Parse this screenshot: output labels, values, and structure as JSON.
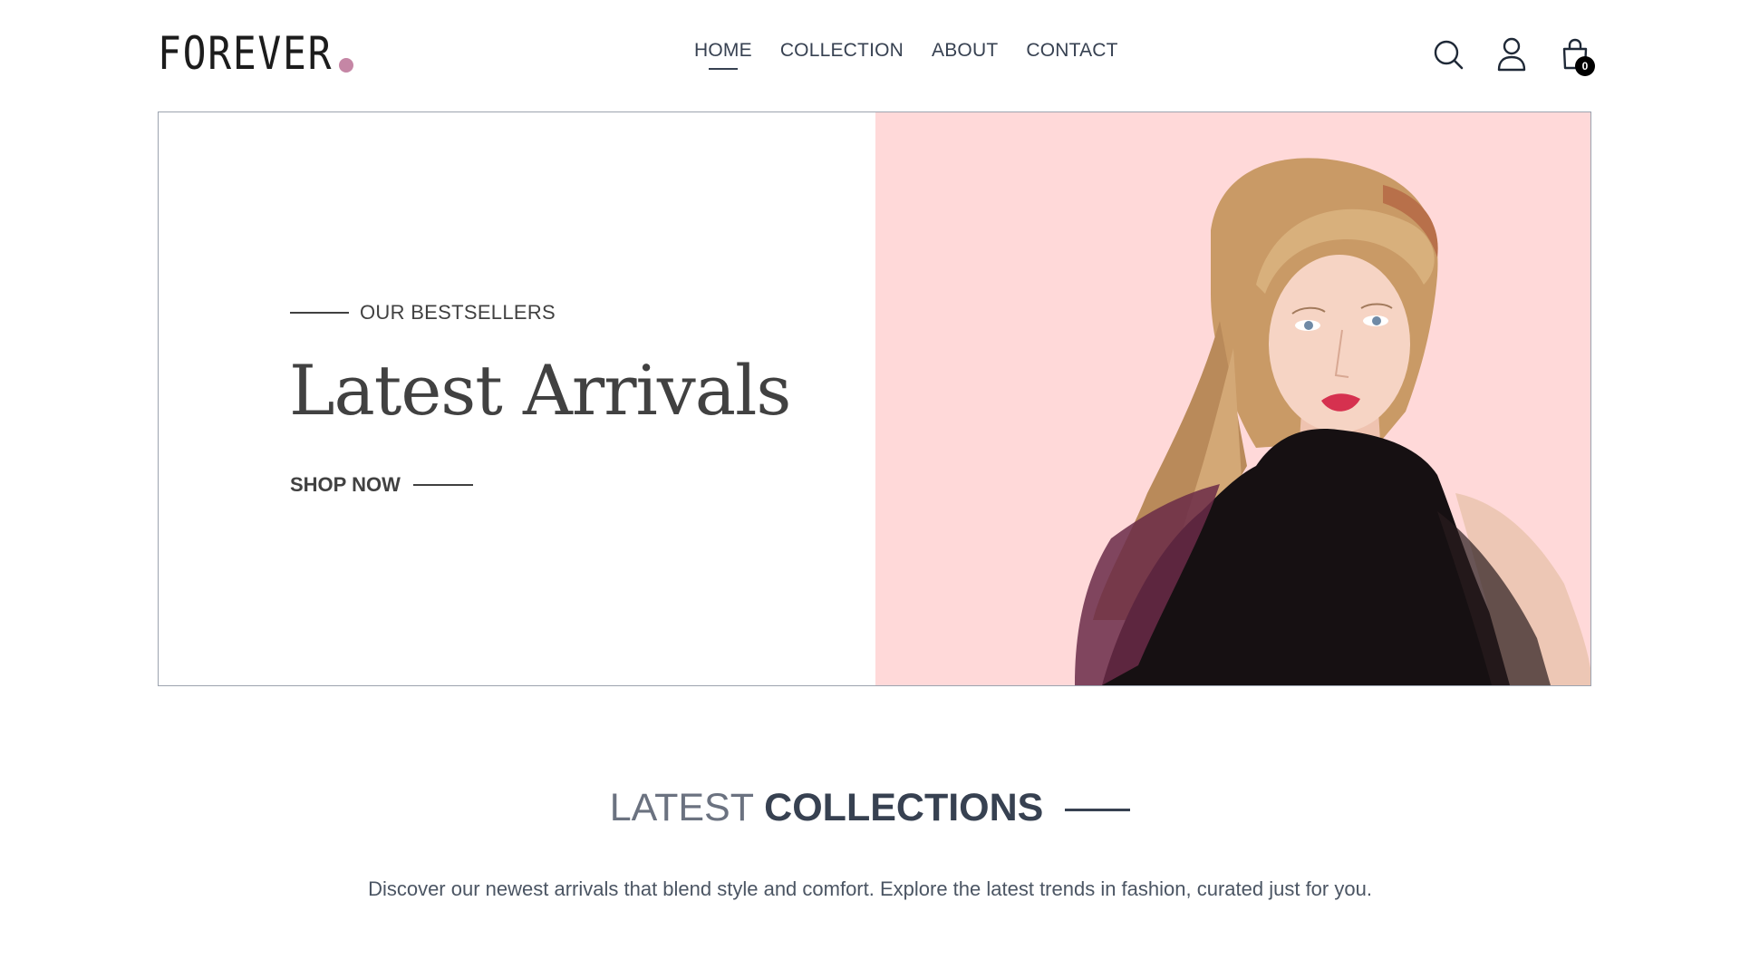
{
  "brand": {
    "logo_text": "FOREVER",
    "dot_color": "#c586a5"
  },
  "nav": {
    "items": [
      {
        "label": "HOME",
        "active": true
      },
      {
        "label": "COLLECTION",
        "active": false
      },
      {
        "label": "ABOUT",
        "active": false
      },
      {
        "label": "CONTACT",
        "active": false
      }
    ]
  },
  "header_icons": {
    "search": "search-icon",
    "profile": "profile-icon",
    "cart": "cart-icon",
    "cart_count": "0"
  },
  "hero": {
    "eyebrow": "OUR BESTSELLERS",
    "title": "Latest Arrivals",
    "cta": "SHOP NOW",
    "image_bg": "#ffd9d9",
    "image": "model-portrait"
  },
  "collections": {
    "title_light": "LATEST",
    "title_bold": "COLLECTIONS",
    "description": "Discover our newest arrivals that blend style and comfort. Explore the latest trends in fashion, curated just for you."
  }
}
